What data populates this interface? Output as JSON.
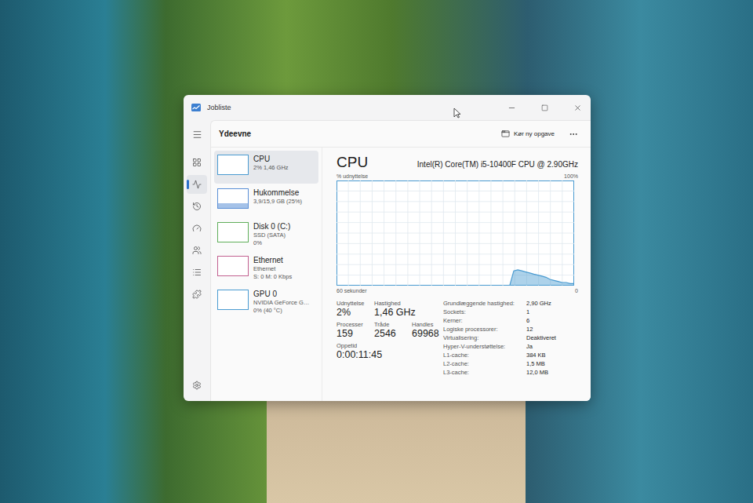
{
  "window": {
    "title": "Jobliste"
  },
  "header": {
    "title": "Ydeevne",
    "run_task": "Kør ny opgave"
  },
  "nav": [
    {
      "selected": false
    },
    {
      "selected": true
    },
    {
      "selected": false
    },
    {
      "selected": false
    },
    {
      "selected": false
    },
    {
      "selected": false
    },
    {
      "selected": false
    }
  ],
  "sidebar": {
    "items": [
      {
        "name": "CPU",
        "details": [
          "2% 1,46 GHz"
        ],
        "selected": true,
        "level": 0.02,
        "color": "#4a9bd1"
      },
      {
        "name": "Hukommelse",
        "details": [
          "3,9/15,9 GB (25%)"
        ],
        "selected": false,
        "level": 0.25,
        "color": "#5b8fd6"
      },
      {
        "name": "Disk 0 (C:)",
        "details": [
          "SSD (SATA)",
          "0%"
        ],
        "selected": false,
        "level": 0,
        "color": "#5fae5a"
      },
      {
        "name": "Ethernet",
        "details": [
          "Ethernet",
          "S: 0 M: 0 Kbps"
        ],
        "selected": false,
        "level": 0,
        "color": "#c2608f"
      },
      {
        "name": "GPU 0",
        "details": [
          "NVIDIA GeForce G…",
          "0% (40 °C)"
        ],
        "selected": false,
        "level": 0,
        "color": "#4a9bd1"
      }
    ]
  },
  "main": {
    "title": "CPU",
    "model": "Intel(R) Core(TM) i5-10400F CPU @ 2.90GHz",
    "axis_label": "% udnyttelse",
    "axis_max": "100%",
    "time_label": "60 sekunder",
    "axis_min": "0",
    "series": [
      0,
      0,
      0,
      0,
      0,
      0,
      0,
      0,
      0,
      0,
      0,
      0,
      0,
      0,
      0,
      0,
      0,
      0,
      0,
      0,
      0,
      0,
      0,
      0,
      0,
      0,
      0,
      0,
      0,
      0,
      0,
      0,
      0,
      0,
      0,
      0,
      0,
      0,
      0,
      0,
      0,
      0,
      0,
      0,
      14,
      15,
      14,
      13,
      12,
      11,
      10,
      9,
      8,
      6,
      5,
      4,
      3,
      3,
      2,
      2
    ]
  },
  "stat_rows": [
    [
      {
        "label": "Udnyttelse",
        "value": "2%"
      },
      {
        "label": "Hastighed",
        "value": "1,46 GHz"
      }
    ],
    [
      {
        "label": "Processer",
        "value": "159"
      },
      {
        "label": "Tråde",
        "value": "2546"
      },
      {
        "label": "Handles",
        "value": "69968"
      }
    ],
    [
      {
        "label": "Oppetid",
        "value": "0:00:11:45"
      }
    ]
  ],
  "specs": [
    {
      "label": "Grundlæggende hastighed:",
      "value": "2,90 GHz"
    },
    {
      "label": "Sockets:",
      "value": "1"
    },
    {
      "label": "Kerner:",
      "value": "6"
    },
    {
      "label": "Logiske processorer:",
      "value": "12"
    },
    {
      "label": "Virtualisering:",
      "value": "Deaktiveret"
    },
    {
      "label": "Hyper-V-understøttelse:",
      "value": "Ja"
    },
    {
      "label": "L1-cache:",
      "value": "384 KB"
    },
    {
      "label": "L2-cache:",
      "value": "1,5 MB"
    },
    {
      "label": "L3-cache:",
      "value": "12,0 MB"
    }
  ]
}
